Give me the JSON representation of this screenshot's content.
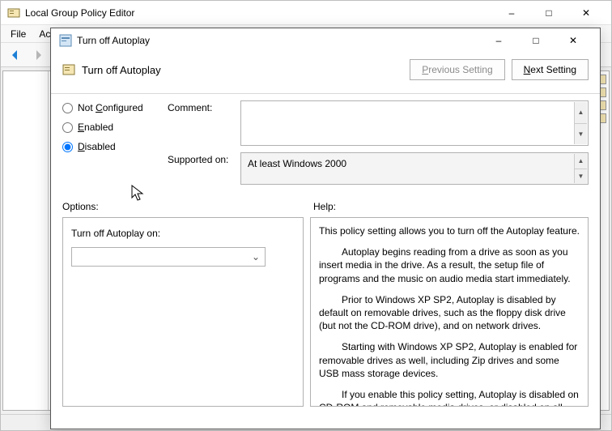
{
  "parent": {
    "title": "Local Group Policy Editor",
    "menubar": {
      "file": "File",
      "action_partial": "Ac"
    }
  },
  "dialog": {
    "title": "Turn off Autoplay",
    "setting_title": "Turn off Autoplay",
    "prev_setting": "Previous Setting",
    "next_setting": "Next Setting",
    "radios": {
      "not_configured_pre": "Not ",
      "not_configured_ul": "C",
      "not_configured_post": "onfigured",
      "enabled_ul": "E",
      "enabled_post": "nabled",
      "disabled_ul": "D",
      "disabled_post": "isabled",
      "selected": "disabled"
    },
    "comment_label": "Comment:",
    "supported_label": "Supported on:",
    "supported_value": "At least Windows 2000",
    "options_label": "Options:",
    "help_label": "Help:",
    "options": {
      "field_label": "Turn off Autoplay on:",
      "selected_value": ""
    },
    "help": {
      "p1": "This policy setting allows you to turn off the Autoplay feature.",
      "p2": "Autoplay begins reading from a drive as soon as you insert media in the drive. As a result, the setup file of programs and the music on audio media start immediately.",
      "p3": "Prior to Windows XP SP2, Autoplay is disabled by default on removable drives, such as the floppy disk drive (but not the CD-ROM drive), and on network drives.",
      "p4": "Starting with Windows XP SP2, Autoplay is enabled for removable drives as well, including Zip drives and some USB mass storage devices.",
      "p5": "If you enable this policy setting, Autoplay is disabled on CD-ROM and removable media drives, or disabled on all drives."
    }
  }
}
